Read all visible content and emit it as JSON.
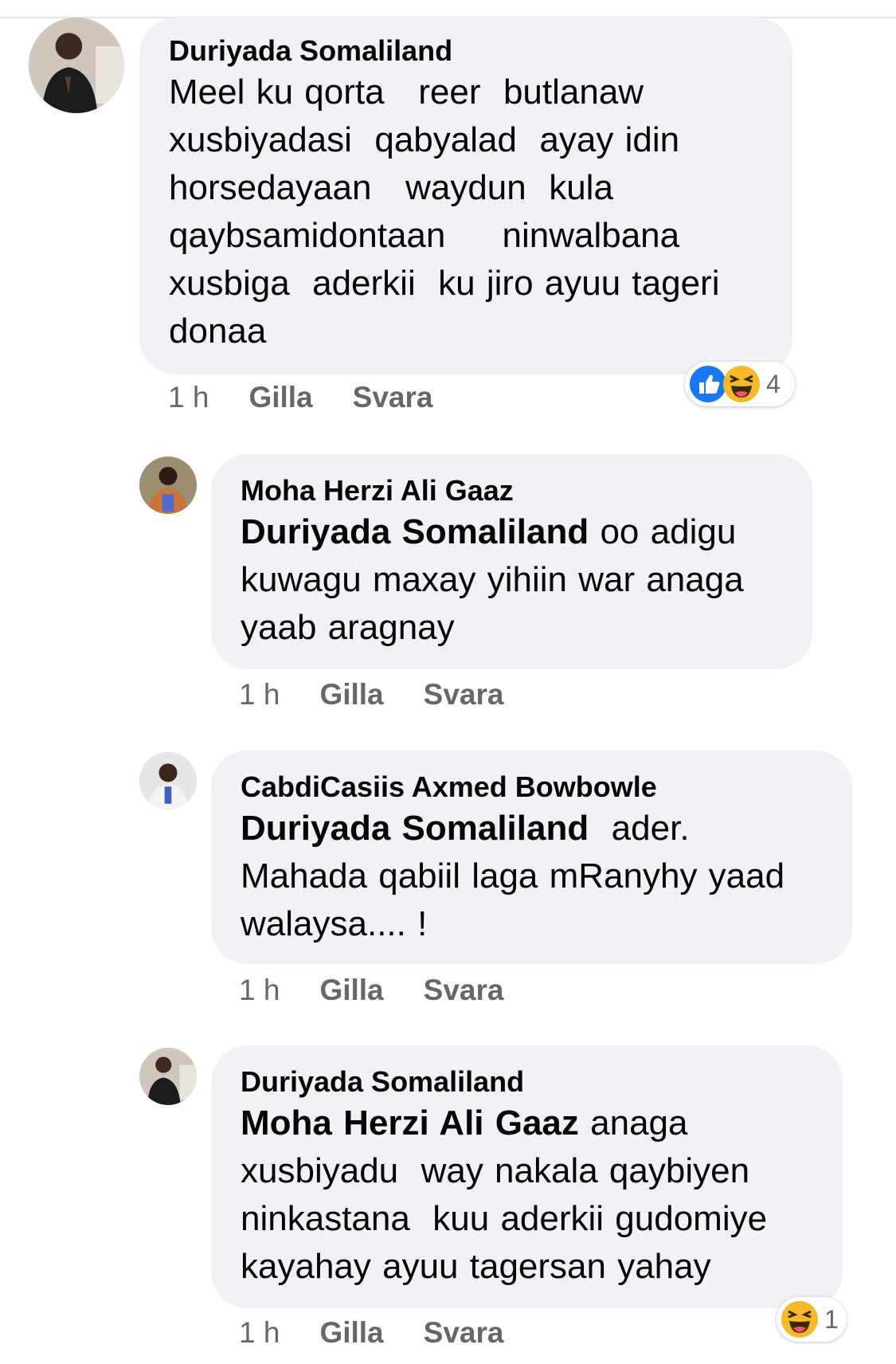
{
  "comments": [
    {
      "author": "Duriyada Somaliland",
      "mention": "",
      "text": "Meel ku qorta   reer  butlanaw\nxusbiyadasi  qabyalad  ayay idin\nhorsedayaan   waydun  kula\nqaybsamidontaan     ninwalbana\nxusbiga  aderkii  ku jiro ayuu tageri\ndonaa",
      "time": "1 h",
      "like_label": "Gilla",
      "reply_label": "Svara",
      "reaction_count": "4",
      "reactions": [
        "like-icon",
        "haha-icon"
      ]
    },
    {
      "author": "Moha Herzi Ali Gaaz",
      "mention": "Duriyada Somaliland",
      "text": " oo adigu\nkuwagu maxay yihiin war anaga\nyaab aragnay",
      "time": "1 h",
      "like_label": "Gilla",
      "reply_label": "Svara"
    },
    {
      "author": "CabdiCasiis Axmed Bowbowle",
      "mention": "Duriyada Somaliland",
      "text": "  ader.\nMahada qabiil laga mRanyhy yaad\nwalaysa.... !",
      "time": "1 h",
      "like_label": "Gilla",
      "reply_label": "Svara"
    },
    {
      "author": "Duriyada Somaliland",
      "mention": "Moha Herzi Ali Gaaz",
      "text": " anaga\nxusbiyadu  way nakala qaybiyen\nninkastana  kuu aderkii gudomiye\nkayahay ayuu tagersan yahay",
      "time": "1 h",
      "like_label": "Gilla",
      "reply_label": "Svara",
      "reaction_count": "1",
      "reactions": [
        "haha-icon"
      ]
    }
  ],
  "colors": {
    "bubble": "#f0f2f5",
    "meta_text": "#65676b",
    "like_blue": "#1877f2",
    "haha_yellow": "#f7b928"
  }
}
